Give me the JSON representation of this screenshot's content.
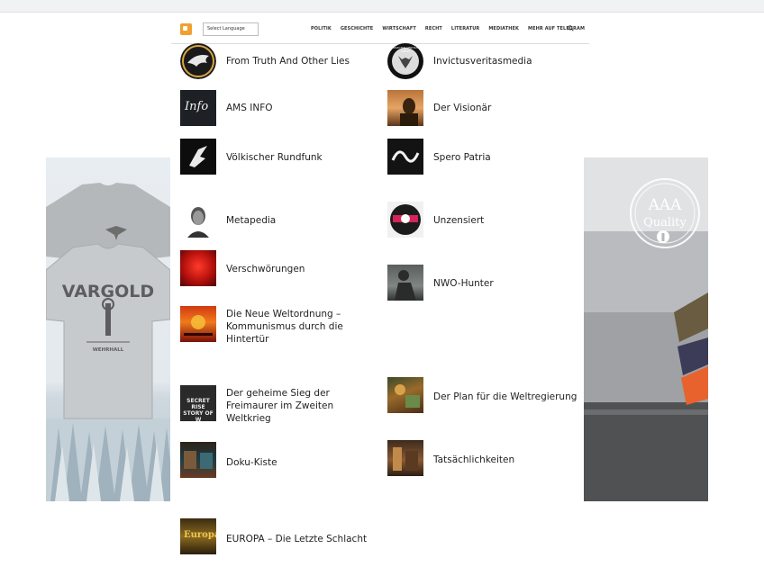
{
  "nav": {
    "language_select": "Select Language",
    "items": [
      "POLITIK",
      "GESCHICHTE",
      "WIRTSCHAFT",
      "RECHT",
      "LITERATUR",
      "MEDIATHEK",
      "MEHR AUF TELEGRAM"
    ],
    "search_icon": "search-icon"
  },
  "ads": {
    "left": {
      "brand": "VARGOLD",
      "subtitle": "WEHRHALL"
    },
    "right": {
      "badge_line1": "AAA",
      "badge_line2": "Quality"
    }
  },
  "left_column": [
    {
      "title": "From Truth And Other Lies"
    },
    {
      "title": "AMS INFO",
      "thumb_text": "Info"
    },
    {
      "title": "Völkischer Rundfunk"
    },
    {
      "title": "Metapedia"
    },
    {
      "title": "Verschwörungen"
    },
    {
      "title": "Die Neue Weltordnung – Kommunismus durch die Hintertür"
    },
    {
      "title": "Der geheime Sieg der Freimaurer im Zweiten Weltkrieg",
      "thumb_text": "SECRET RISE STORY OF W"
    },
    {
      "title": "Doku-Kiste"
    },
    {
      "title": "EUROPA – Die Letzte Schlacht",
      "thumb_text": "Europa"
    }
  ],
  "right_column": [
    {
      "title": "Invictusveritasmedia",
      "thumb_text": "INVICTUS VERITAS MEDIA"
    },
    {
      "title": "Der Visionär"
    },
    {
      "title": "Spero Patria"
    },
    {
      "title": "Unzensiert"
    },
    {
      "title": "NWO-Hunter"
    },
    {
      "title": "Der Plan für die Weltregierung"
    },
    {
      "title": "Tatsächlichkeiten"
    }
  ],
  "colors": {
    "accent": "#f0a030",
    "text": "#222222",
    "nav_text": "#333333"
  }
}
